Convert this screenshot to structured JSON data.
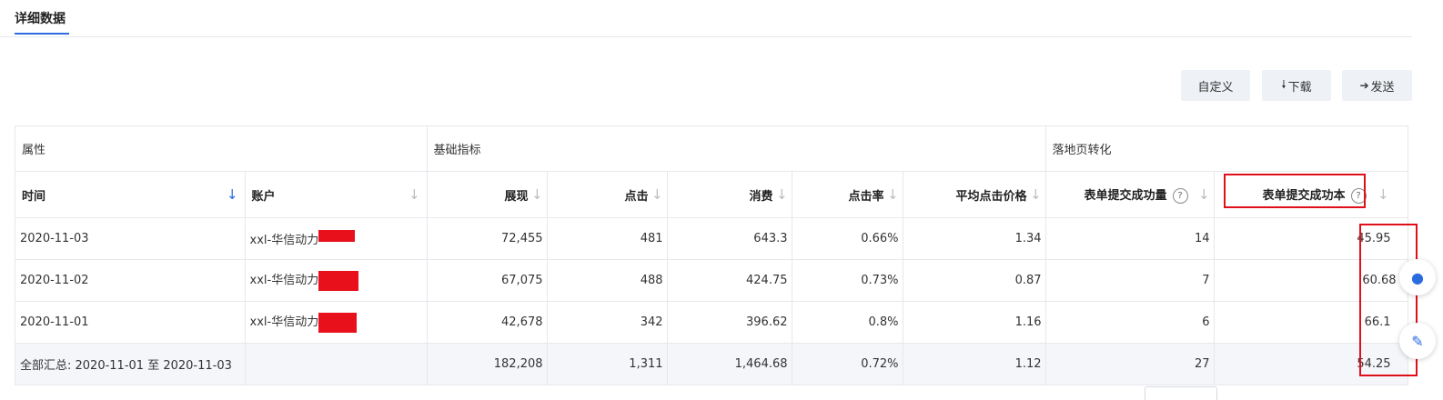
{
  "tab": {
    "label": "详细数据"
  },
  "toolbar": {
    "custom_label": "自定义",
    "download_label": "下载",
    "send_label": "发送",
    "download_icon": "down-arrow-icon",
    "send_icon": "right-arrow-icon"
  },
  "table": {
    "groups": [
      "属性",
      "基础指标",
      "落地页转化"
    ],
    "columns": [
      "时间",
      "账户",
      "展现",
      "点击",
      "消费",
      "点击率",
      "平均点击价格",
      "表单提交成功量",
      "表单提交成功本"
    ],
    "rows": [
      {
        "date": "2020-11-03",
        "account": "xxl-华信动力",
        "impressions": "72,455",
        "clicks": "481",
        "cost": "643.3",
        "ctr": "0.66%",
        "cpc": "1.34",
        "form_count": "14",
        "form_cost": "45.95"
      },
      {
        "date": "2020-11-02",
        "account": "xxl-华信动力",
        "impressions": "67,075",
        "clicks": "488",
        "cost": "424.75",
        "ctr": "0.73%",
        "cpc": "0.87",
        "form_count": "7",
        "form_cost": "60.68"
      },
      {
        "date": "2020-11-01",
        "account": "xxl-华信动力",
        "impressions": "42,678",
        "clicks": "342",
        "cost": "396.62",
        "ctr": "0.8%",
        "cpc": "1.16",
        "form_count": "6",
        "form_cost": "66.1"
      }
    ],
    "total": {
      "label": "全部汇总: 2020-11-01 至 2020-11-03",
      "impressions": "182,208",
      "clicks": "1,311",
      "cost": "1,464.68",
      "ctr": "0.72%",
      "cpc": "1.12",
      "form_count": "27",
      "form_cost": "54.25"
    }
  },
  "colors": {
    "accent": "#2a6be0",
    "highlight": "#e0101a",
    "redaction": "#e8101a"
  }
}
